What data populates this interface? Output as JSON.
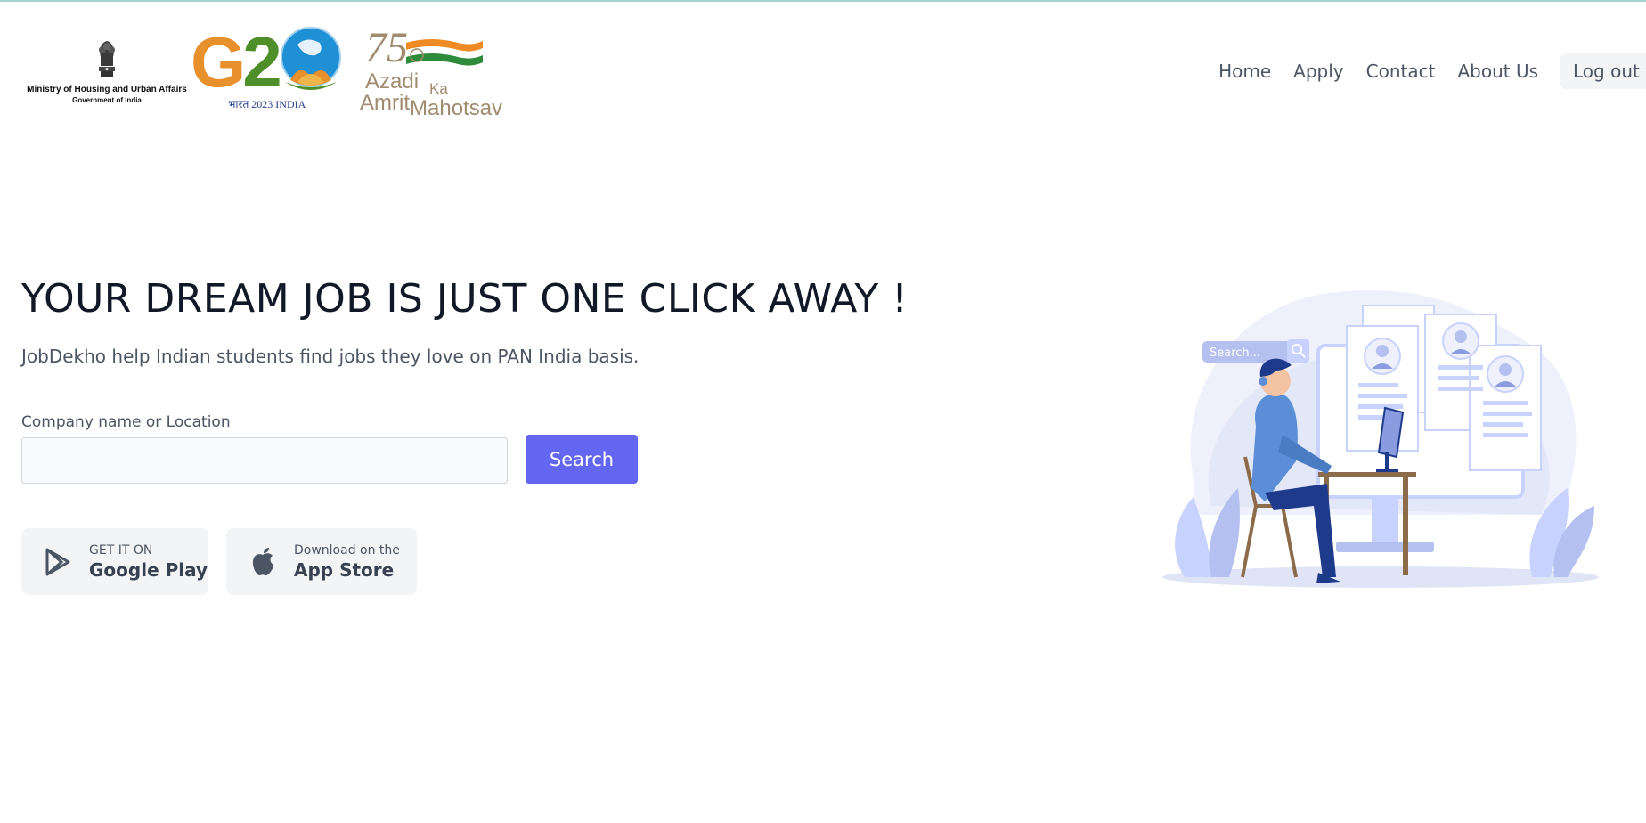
{
  "header": {
    "ministry_logo": {
      "name": "Ministry of Housing and Urban Affairs",
      "sub": "Government of India"
    },
    "g20_logo": {
      "mark": "G20",
      "sub": "भारत 2023 INDIA"
    },
    "akam_logo": {
      "mark": "75",
      "line1": "Azadi",
      "line1_suffix": "Ka",
      "line2": "Amrit",
      "line3": "Mahotsav"
    },
    "nav": {
      "items": [
        "Home",
        "Apply",
        "Contact",
        "About Us"
      ],
      "logout_label": "Log out"
    }
  },
  "hero": {
    "title": "YOUR DREAM JOB IS JUST ONE CLICK AWAY !",
    "subtitle": "JobDekho help Indian students find jobs they love on PAN India basis."
  },
  "search": {
    "label": "Company name or Location",
    "value": "",
    "placeholder": "",
    "button_label": "Search"
  },
  "stores": {
    "google_play": {
      "small": "GET IT ON",
      "big": "Google Play",
      "icon": "google-play-icon"
    },
    "app_store": {
      "small": "Download on the",
      "big": "App Store",
      "icon": "apple-icon"
    }
  },
  "illustration": {
    "search_text": "Search..."
  },
  "colors": {
    "accent": "#6366f1",
    "nav_text": "#4b5563",
    "title_text": "#111827",
    "store_bg": "#f3f4f6",
    "illustration_primary": "#c7d2fe",
    "illustration_dark": "#1e3a8a"
  }
}
